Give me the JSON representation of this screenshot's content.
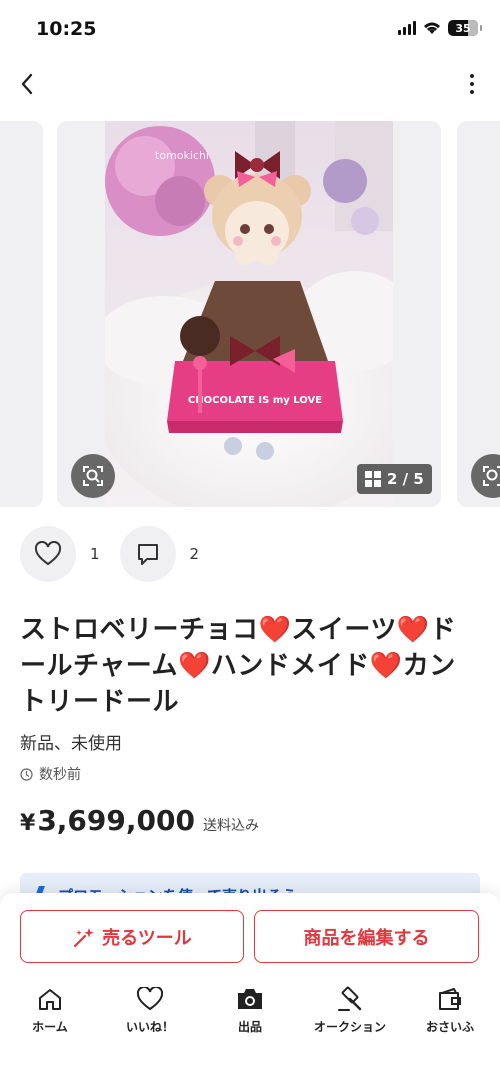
{
  "status_bar": {
    "time": "10:25",
    "battery": "35"
  },
  "carousel": {
    "prev_counter": "/ 5",
    "current_counter": "2 / 5",
    "watermark": "tomokichi"
  },
  "reactions": {
    "likes": "1",
    "comments": "2"
  },
  "item": {
    "title_parts": [
      "ストロベリーチョコ",
      "❤️",
      "スイーツ",
      "❤️",
      "ドールチャーム",
      "❤️",
      "ハンドメイド",
      "❤️",
      "カントリードール"
    ],
    "condition": "新品、未使用",
    "posted": "数秒前",
    "currency": "¥",
    "price": "3,699,000",
    "shipping": "送料込み"
  },
  "promo": {
    "text": "プロモーションを使って売り出そう"
  },
  "actions": {
    "sell_tools": "売るツール",
    "edit_item": "商品を編集する"
  },
  "tabs": [
    {
      "label": "ホーム",
      "icon": "home-icon"
    },
    {
      "label": "いいね！",
      "icon": "heart-icon"
    },
    {
      "label": "出品",
      "icon": "camera-icon"
    },
    {
      "label": "オークション",
      "icon": "gavel-icon"
    },
    {
      "label": "おさいふ",
      "icon": "wallet-icon"
    }
  ],
  "colors": {
    "accent": "#e0383e",
    "heart": "#e02020",
    "promo_bg": "#e6eef9"
  }
}
